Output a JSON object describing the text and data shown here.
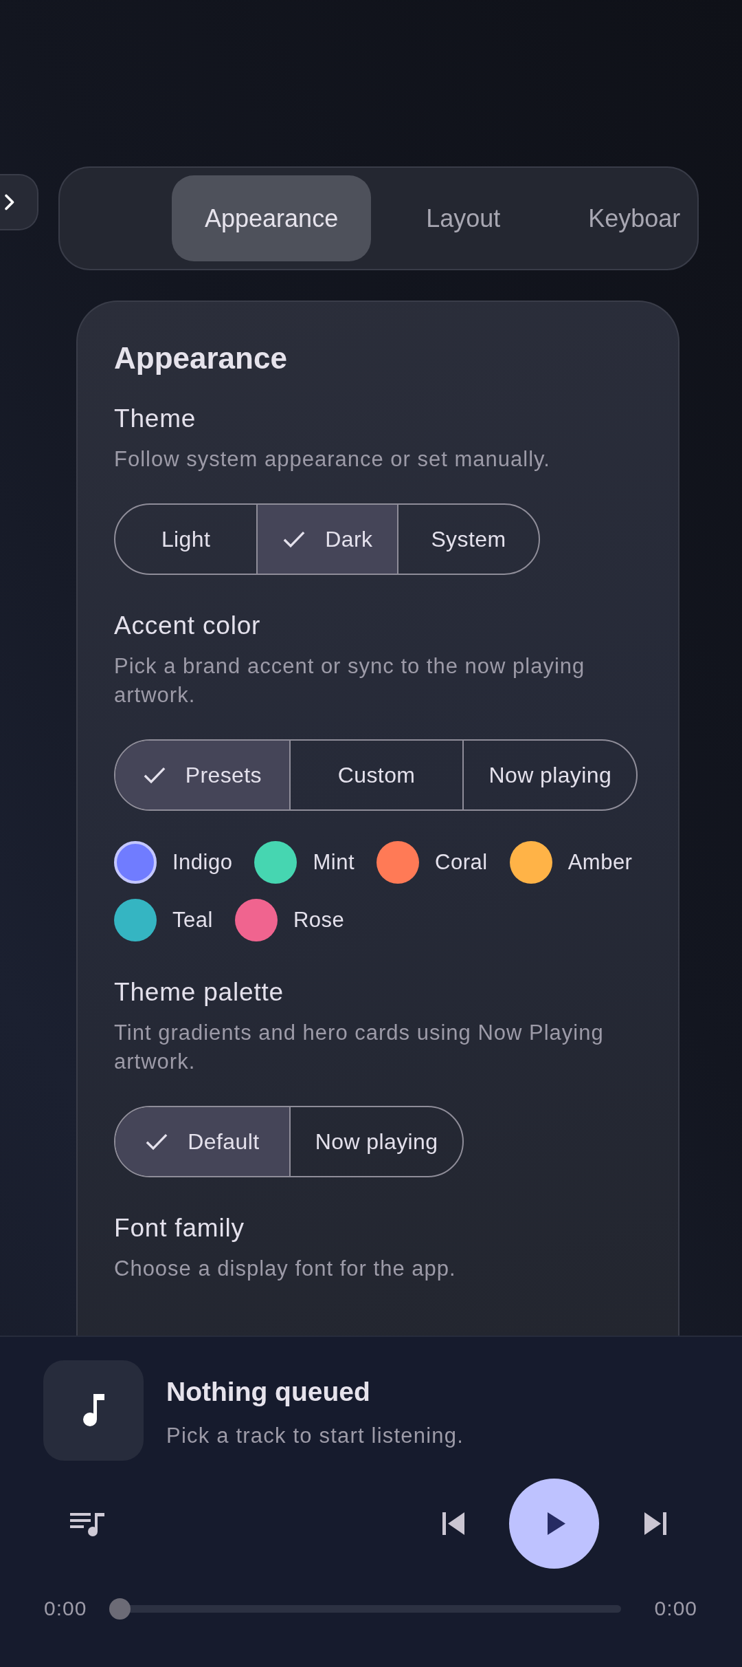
{
  "tabs": [
    {
      "label": "Appearance",
      "selected": true
    },
    {
      "label": "Layout",
      "selected": false
    },
    {
      "label": "Keyboar",
      "selected": false
    }
  ],
  "card": {
    "title": "Appearance",
    "sections": [
      {
        "title": "Theme",
        "description": "Follow system appearance or set manually.",
        "options": [
          {
            "label": "Light",
            "selected": false
          },
          {
            "label": "Dark",
            "selected": true
          },
          {
            "label": "System",
            "selected": false
          }
        ]
      },
      {
        "title": "Accent color",
        "description": "Pick a brand accent or sync to the now playing artwork.",
        "options": [
          {
            "label": "Presets",
            "selected": true
          },
          {
            "label": "Custom",
            "selected": false
          },
          {
            "label": "Now playing",
            "selected": false
          }
        ],
        "swatches": [
          {
            "label": "Indigo",
            "color": "#707cff",
            "selected": true
          },
          {
            "label": "Mint",
            "color": "#46d6b1",
            "selected": false
          },
          {
            "label": "Coral",
            "color": "#ff7a56",
            "selected": false
          },
          {
            "label": "Amber",
            "color": "#ffb347",
            "selected": false
          },
          {
            "label": "Teal",
            "color": "#35b5c2",
            "selected": false
          },
          {
            "label": "Rose",
            "color": "#f0648f",
            "selected": false
          }
        ]
      },
      {
        "title": "Theme palette",
        "description": "Tint gradients and hero cards using Now Playing artwork.",
        "options": [
          {
            "label": "Default",
            "selected": true
          },
          {
            "label": "Now playing",
            "selected": false
          }
        ]
      },
      {
        "title": "Font family",
        "description": "Choose a display font for the app."
      }
    ]
  },
  "player": {
    "title": "Nothing queued",
    "subtitle": "Pick a track to start listening.",
    "playing": false,
    "elapsed": "0:00",
    "level": 0,
    "duration": "0:00"
  }
}
